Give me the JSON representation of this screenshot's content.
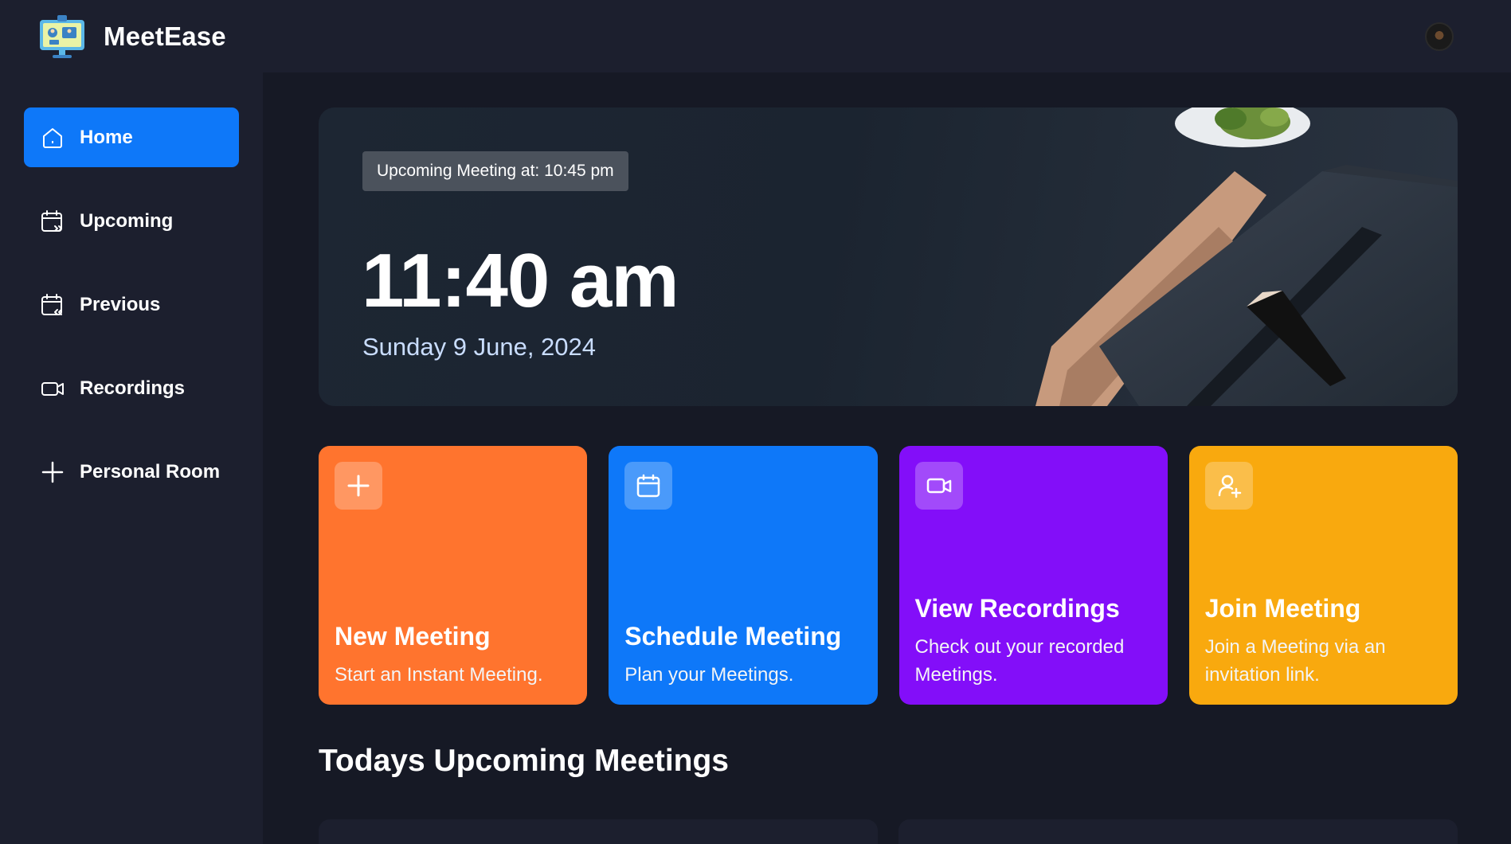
{
  "app": {
    "name": "MeetEase"
  },
  "topbar": {
    "logo_icon": "meetease-logo-icon",
    "avatar_icon": "user-avatar-icon"
  },
  "sidebar": {
    "items": [
      {
        "label": "Home",
        "icon": "home-icon",
        "active": true
      },
      {
        "label": "Upcoming",
        "icon": "calendar-forward-icon",
        "active": false
      },
      {
        "label": "Previous",
        "icon": "calendar-back-icon",
        "active": false
      },
      {
        "label": "Recordings",
        "icon": "video-icon",
        "active": false
      },
      {
        "label": "Personal Room",
        "icon": "plus-icon",
        "active": false
      }
    ]
  },
  "hero": {
    "upcoming_label": "Upcoming Meeting at: 10:45 pm",
    "time": "11:40 am",
    "date": "Sunday 9 June, 2024"
  },
  "cards": [
    {
      "title": "New Meeting",
      "subtitle": "Start an Instant Meeting.",
      "icon": "plus-icon",
      "color": "#ff742e"
    },
    {
      "title": "Schedule Meeting",
      "subtitle": "Plan your Meetings.",
      "icon": "calendar-icon",
      "color": "#0e78f9"
    },
    {
      "title": "View Recordings",
      "subtitle": "Check out your recorded Meetings.",
      "icon": "video-icon",
      "color": "#830ef9"
    },
    {
      "title": "Join Meeting",
      "subtitle": "Join a Meeting via an invitation link.",
      "icon": "user-add-icon",
      "color": "#f9a90e"
    }
  ],
  "section": {
    "title": "Todays Upcoming Meetings"
  },
  "colors": {
    "background": "#161925",
    "sidebar": "#1c1f2e",
    "accent": "#0e78f9",
    "date_text": "#c9ddff"
  }
}
